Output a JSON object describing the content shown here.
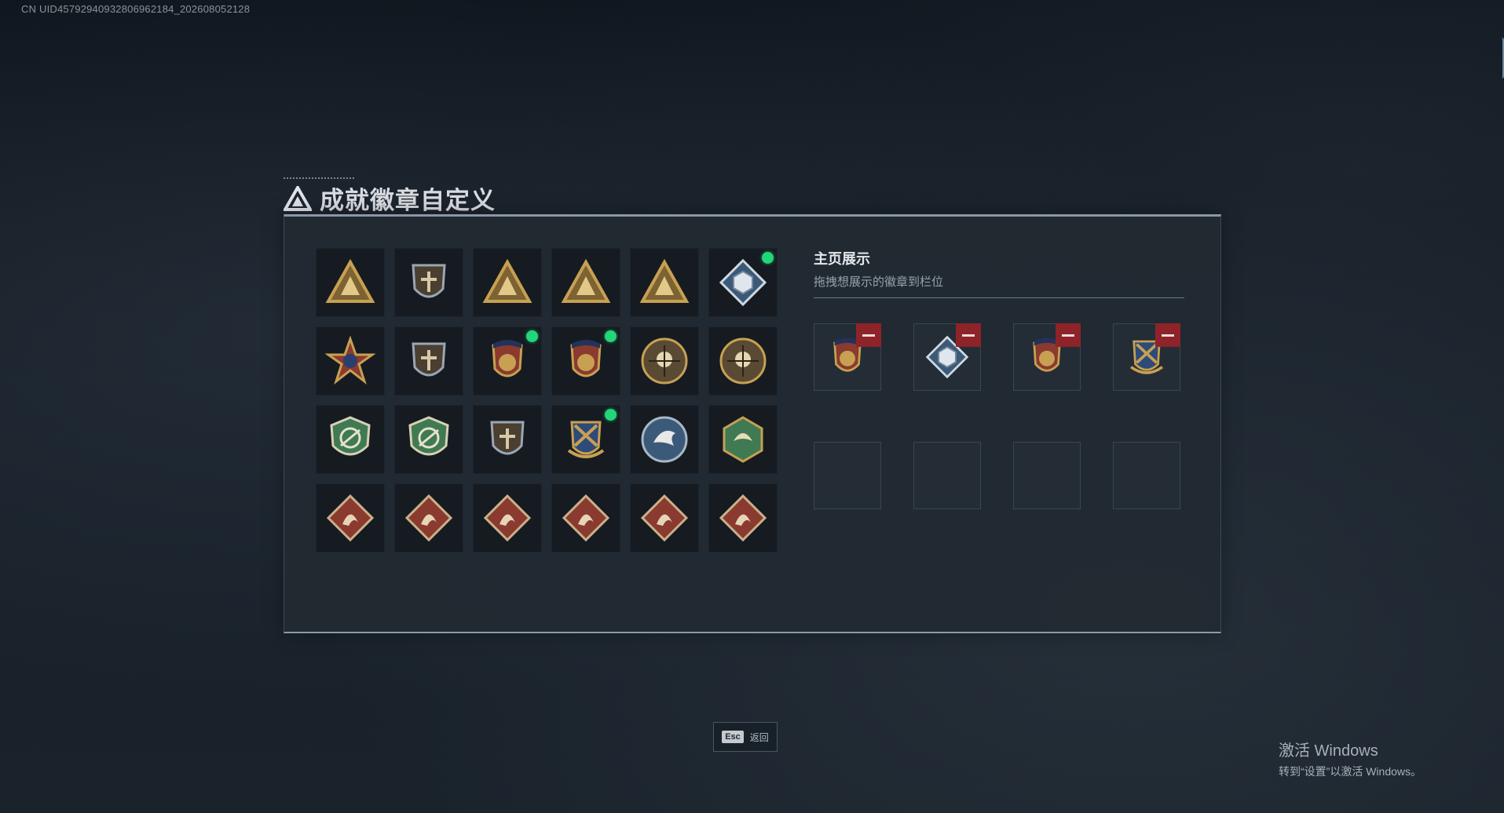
{
  "uid_text": "CN UID4579294093280696218​4_202608052128",
  "title": "成就徽章自定义",
  "badge_grid": [
    {
      "icon": "triangle-shield-badge-icon",
      "selected": false
    },
    {
      "icon": "helicopter-badge-icon",
      "selected": false
    },
    {
      "icon": "sunrise-triangle-badge-icon",
      "selected": false
    },
    {
      "icon": "number-one-triangle-badge-icon",
      "selected": false
    },
    {
      "icon": "soldiers-triangle-badge-icon",
      "selected": false
    },
    {
      "icon": "crystal-cube-badge-icon",
      "selected": true
    },
    {
      "icon": "red-star-medal-badge-icon",
      "selected": false
    },
    {
      "icon": "eagle-shield-badge-icon",
      "selected": false
    },
    {
      "icon": "red-shield-coin-badge-icon",
      "selected": true
    },
    {
      "icon": "red-shield-hexagram-badge-icon",
      "selected": true
    },
    {
      "icon": "skull-crosshair-badge-icon",
      "selected": false
    },
    {
      "icon": "fist-coin-badge-icon",
      "selected": false
    },
    {
      "icon": "green-rifle-shield-badge-icon",
      "selected": false
    },
    {
      "icon": "green-rifle-shield-2-badge-icon",
      "selected": false
    },
    {
      "icon": "knife-shield-badge-icon",
      "selected": false
    },
    {
      "icon": "golden-crossed-swords-badge-icon",
      "selected": true
    },
    {
      "icon": "eagle-head-badge-icon",
      "selected": false
    },
    {
      "icon": "winged-hexagon-badge-icon",
      "selected": false
    },
    {
      "icon": "dragon-diamond-badge-icon",
      "selected": false
    },
    {
      "icon": "dragon-diamond-2-badge-icon",
      "selected": false
    },
    {
      "icon": "runner-diamond-badge-icon",
      "selected": false
    },
    {
      "icon": "horse-diamond-badge-icon",
      "selected": false
    },
    {
      "icon": "horse-diamond-2-badge-icon",
      "selected": false
    },
    {
      "icon": "medic-diamond-badge-icon",
      "selected": false
    }
  ],
  "showcase": {
    "title": "主页展示",
    "subtitle": "拖拽想展示的徽章到栏位",
    "slots": [
      {
        "icon": "red-shield-hexagram-badge-icon",
        "filled": true
      },
      {
        "icon": "crystal-cube-badge-icon",
        "filled": true
      },
      {
        "icon": "red-shield-coin-badge-icon",
        "filled": true
      },
      {
        "icon": "golden-crossed-swords-badge-icon",
        "filled": true
      },
      {
        "icon": "",
        "filled": false
      },
      {
        "icon": "",
        "filled": false
      },
      {
        "icon": "",
        "filled": false
      },
      {
        "icon": "",
        "filled": false
      }
    ]
  },
  "footer": {
    "esc_key": "Esc",
    "esc_label": "返回"
  },
  "watermark": {
    "line1": "激活 Windows",
    "line2": "转到“设置”以激活 Windows。"
  },
  "colors": {
    "selected_dot": "#22d679",
    "remove_button": "#8e2329",
    "accent_gold": "#c7a052",
    "accent_red": "#8a3a2e",
    "accent_green": "#3f7a52"
  }
}
